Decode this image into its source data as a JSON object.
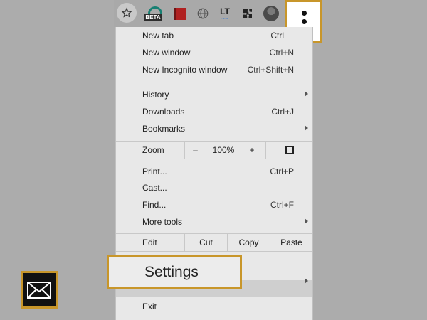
{
  "toolbar": {
    "beta_badge": "BETA",
    "lt_label": "LT",
    "icons": [
      "star-icon",
      "beta-extension-icon",
      "book-extension-icon",
      "globe-icon",
      "languagetool-icon",
      "puzzle-icon",
      "profile-avatar",
      "more-menu-icon"
    ]
  },
  "menu": {
    "new_tab": {
      "label": "New tab",
      "shortcut": "Ctrl"
    },
    "new_window": {
      "label": "New window",
      "shortcut": "Ctrl+N"
    },
    "new_incognito": {
      "label": "New Incognito window",
      "shortcut": "Ctrl+Shift+N"
    },
    "history": {
      "label": "History"
    },
    "downloads": {
      "label": "Downloads",
      "shortcut": "Ctrl+J"
    },
    "bookmarks": {
      "label": "Bookmarks"
    },
    "zoom": {
      "label": "Zoom",
      "minus": "–",
      "level": "100%",
      "plus": "+"
    },
    "print": {
      "label": "Print...",
      "shortcut": "Ctrl+P"
    },
    "cast": {
      "label": "Cast..."
    },
    "find": {
      "label": "Find...",
      "shortcut": "Ctrl+F"
    },
    "more_tools": {
      "label": "More tools"
    },
    "edit": {
      "label": "Edit",
      "cut": "Cut",
      "copy": "Copy",
      "paste": "Paste"
    },
    "settings": {
      "label": "Settings"
    },
    "exit": {
      "label": "Exit"
    }
  },
  "colors": {
    "highlight_border": "#c8962a",
    "background": "#acacac",
    "menu_bg": "#e8e8e8"
  }
}
